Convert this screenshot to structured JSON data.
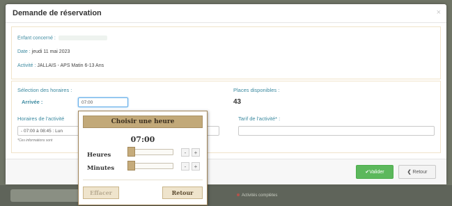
{
  "modal": {
    "title": "Demande de réservation",
    "close_icon": "close-icon"
  },
  "info": {
    "enfant_label": "Enfant concerné :",
    "date_label": "Date :",
    "date_value": "jeudi 11 mai 2023",
    "activite_label": "Activité :",
    "activite_value": "JALLAIS - APS Matin 6-13 Ans"
  },
  "form": {
    "selection_label": "Sélection des horaires :",
    "arrivee_label": "Arrivée :",
    "arrivee_value": "07:00",
    "places_label": "Places disponibles :",
    "places_value": "43",
    "horaires_label": "Horaires de l'activité",
    "horaires_value": "- 07:00 à 08:45 : Lun",
    "tarif_label": "Tarif de l'activité* :",
    "note": "*Ces informations sont"
  },
  "footer": {
    "valider_label": "Valider",
    "retour_label": "Retour"
  },
  "time_picker": {
    "title": "Choisir une heure",
    "time_display": "07:00",
    "hours_label": "Heures",
    "minutes_label": "Minutes",
    "hours_value": 7,
    "minutes_value": 0,
    "minus": "-",
    "plus": "+",
    "effacer_label": "Effacer",
    "retour_label": "Retour"
  },
  "background": {
    "blurred_text": "Activités complètes"
  },
  "colors": {
    "accent_label": "#3c8aa0",
    "success": "#5cb85c",
    "picker_header": "#c2a979"
  }
}
